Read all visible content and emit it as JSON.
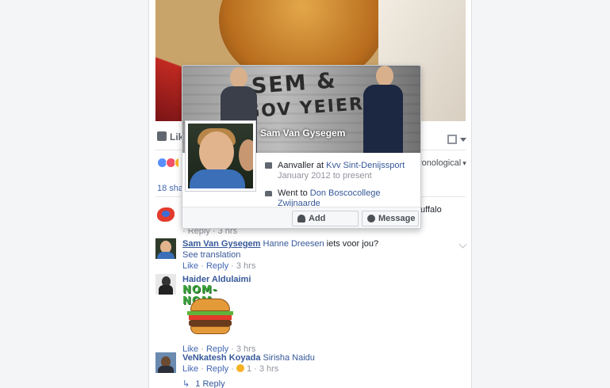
{
  "post": {
    "like_label": "Like",
    "sort_label": "Chronological",
    "sort_visible": "ronological",
    "shares_label": "18 shares",
    "shares_visible": "18 shar"
  },
  "comments": [
    {
      "name": "",
      "text_visible": "uffalo",
      "meta_visible": "· Reply · 3 hrs"
    },
    {
      "name": "Sam Van Gysegem",
      "tag": "Hanne Dreesen",
      "text": " iets voor jou?",
      "see_translation": "See translation",
      "like": "Like",
      "reply": "Reply",
      "time": "3 hrs"
    },
    {
      "name": "Haider Aldulaimi",
      "sticker_text": "NOM-NOM",
      "like": "Like",
      "reply": "Reply",
      "time": "3 hrs"
    },
    {
      "name": "VeNkatesh Koyada",
      "tag": "Sirisha Naidu",
      "like": "Like",
      "reply": "Reply",
      "reaction_count": "1",
      "time": "3 hrs",
      "replies_label": "1 Reply"
    }
  ],
  "hovercard": {
    "name": "Sam Van Gysegem",
    "cover_graffiti_line1": "SEM &",
    "cover_graffiti_line2": "GOV YEIER",
    "work_prefix": "Aanvaller at ",
    "work_place": "Kvv Sint-Denijssport",
    "work_period": "January 2012 to present",
    "school_prefix": "Went to ",
    "school_name": "Don Boscocollege Zwijnaarde",
    "add_friend_label": "Add Friend",
    "message_label": "Message"
  },
  "colors": {
    "link": "#365899",
    "meta": "#90949c",
    "background": "#f4f5f7"
  }
}
